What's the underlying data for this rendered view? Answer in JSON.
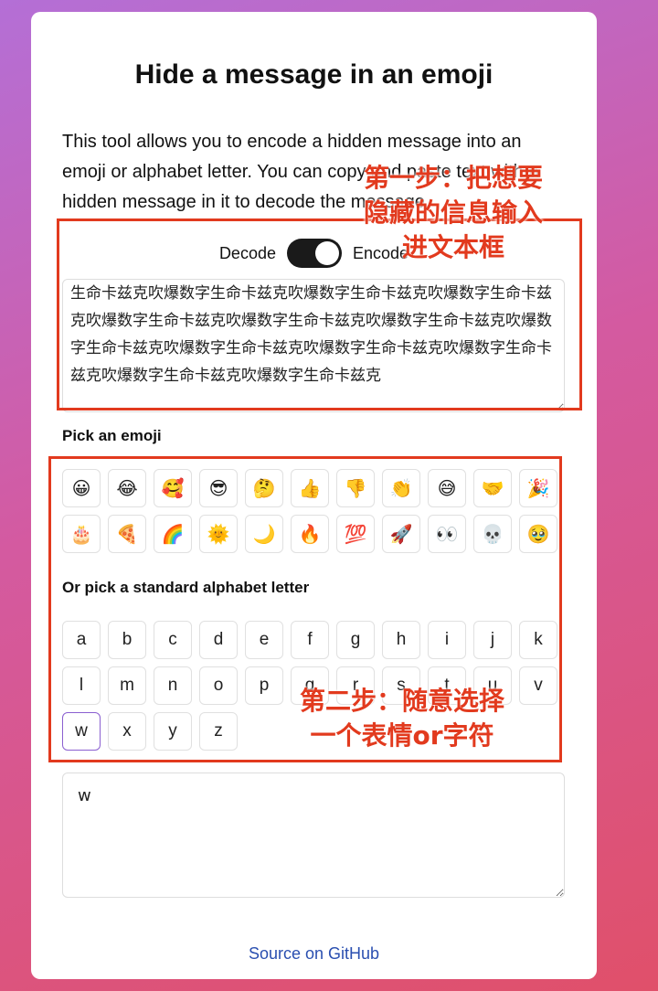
{
  "page": {
    "title": "Hide a message in an emoji",
    "intro": "This tool allows you to encode a hidden message into an emoji or alphabet letter. You can copy and paste text with a hidden message in it to decode the message."
  },
  "mode": {
    "decode_label": "Decode",
    "encode_label": "Encode",
    "selected": "Encode"
  },
  "message_input": {
    "value": "生命卡兹克吹爆数字生命卡兹克吹爆数字生命卡兹克吹爆数字生命卡兹克吹爆数字生命卡兹克吹爆数字生命卡兹克吹爆数字生命卡兹克吹爆数字生命卡兹克吹爆数字生命卡兹克吹爆数字生命卡兹克吹爆数字生命卡兹克吹爆数字生命卡兹克吹爆数字生命卡兹克"
  },
  "emoji_picker": {
    "label": "Pick an emoji",
    "emojis": [
      "😀",
      "😂",
      "🥰",
      "😎",
      "🤔",
      "👍",
      "👎",
      "👏",
      "😅",
      "🤝",
      "🎉",
      "🎂",
      "🍕",
      "🌈",
      "🌞",
      "🌙",
      "🔥",
      "💯",
      "🚀",
      "👀",
      "💀",
      "🥹"
    ]
  },
  "letter_picker": {
    "label": "Or pick a standard alphabet letter",
    "letters": [
      "a",
      "b",
      "c",
      "d",
      "e",
      "f",
      "g",
      "h",
      "i",
      "j",
      "k",
      "l",
      "m",
      "n",
      "o",
      "p",
      "q",
      "r",
      "s",
      "t",
      "u",
      "v",
      "w",
      "x",
      "y",
      "z"
    ],
    "selected": "w"
  },
  "output": {
    "value": "w"
  },
  "footer": {
    "link_label": "Source on GitHub"
  },
  "annotations": {
    "step1": "第一步：把想要\n隐藏的信息输入\n进文本框",
    "step2": "第二步：随意选择\n一个表情or字符",
    "color": "#e23a1e"
  }
}
